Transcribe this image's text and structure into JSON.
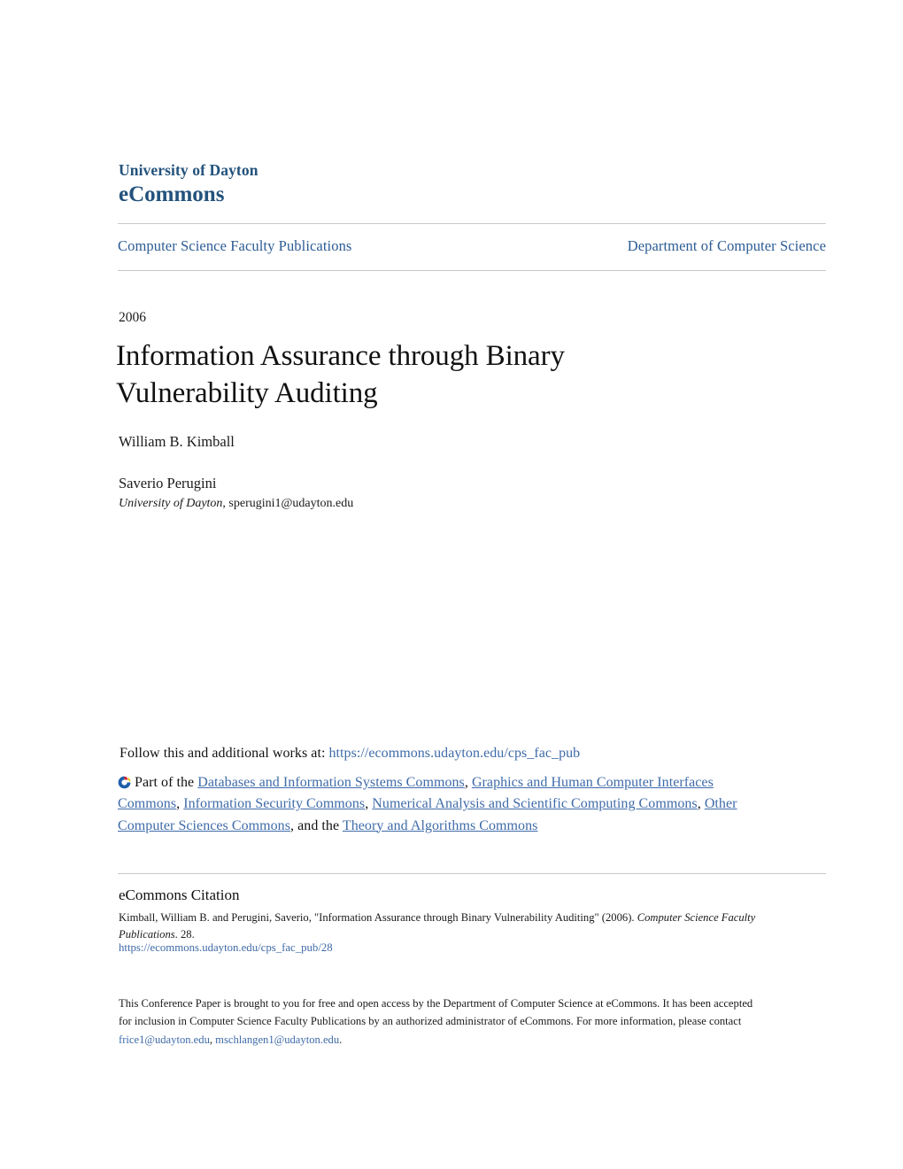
{
  "masthead": {
    "institution": "University of Dayton",
    "repository": "eCommons"
  },
  "nav": {
    "collection": "Computer Science Faculty Publications",
    "department": "Department of Computer Science"
  },
  "article": {
    "year": "2006",
    "title": "Information Assurance through Binary Vulnerability Auditing",
    "author_1": "William B. Kimball",
    "author_2": "Saverio Perugini",
    "author_2_institution": "University of Dayton",
    "author_2_separator": ", ",
    "author_2_email": "sperugini1@udayton.edu"
  },
  "follow": {
    "label": "Follow this and additional works at: ",
    "url_text": "https://ecommons.udayton.edu/cps_fac_pub"
  },
  "subjects": {
    "icon": "digital-commons-network-icon",
    "lead": "Part of the ",
    "links": [
      "Databases and Information Systems Commons",
      "Graphics and Human Computer Interfaces Commons",
      "Information Security Commons",
      "Numerical Analysis and Scientific Computing Commons",
      "Other Computer Sciences Commons",
      "Theory and Algorithms Commons"
    ],
    "separator": ", ",
    "conjunction": ", and the "
  },
  "citation": {
    "heading": "eCommons Citation",
    "text_part_1": "Kimball, William B. and Perugini, Saverio, \"Information Assurance through Binary Vulnerability Auditing\" (2006). ",
    "publication_italic": "Computer Science Faculty Publications",
    "text_part_2": ". 28.",
    "url": "https://ecommons.udayton.edu/cps_fac_pub/28"
  },
  "footer": {
    "text_part_1": "This Conference Paper is brought to you for free and open access by the Department of Computer Science at eCommons. It has been accepted for inclusion in Computer Science Faculty Publications by an authorized administrator of eCommons. For more information, please contact ",
    "email_1": "frice1@udayton.edu",
    "email_separator": ", ",
    "email_2": "mschlangen1@udayton.edu",
    "text_part_2": "."
  },
  "colors": {
    "brand_blue": "#23527c",
    "link_blue": "#3f6ba8",
    "nav_blue": "#2c5c94",
    "rule_gray": "#c9c9c9",
    "icon_blue": "#1f5fa9",
    "icon_red": "#d5202c",
    "icon_yellow": "#f4c20d"
  }
}
